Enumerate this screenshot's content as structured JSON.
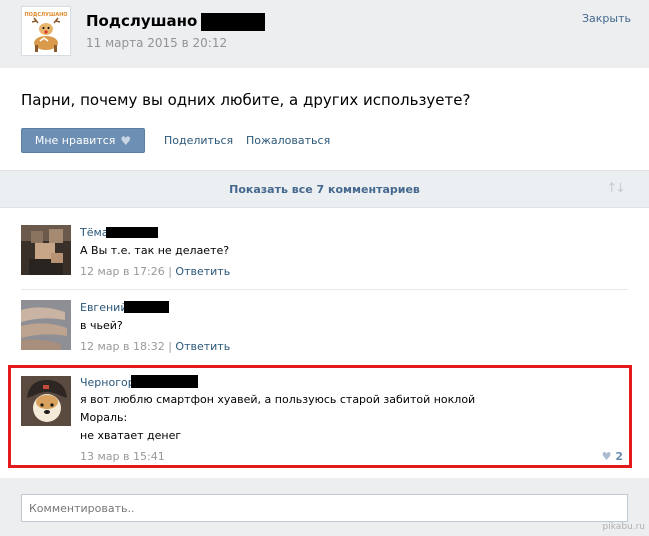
{
  "header": {
    "group_name": "Подслушано в",
    "logo_text": "ПОДСЛУШАНО",
    "post_date": "11 марта 2015 в 20:12",
    "close_label": "Закрыть"
  },
  "post": {
    "text": "Парни, почему вы одних любите, а других используете?",
    "like_label": "Мне нравится",
    "share_label": "Поделиться",
    "report_label": "Пожаловаться"
  },
  "comments_bar": {
    "show_all_label": "Показать все 7 комментариев"
  },
  "comments": [
    {
      "author": "Тёма",
      "text": "А Вы т.е. так не делаете?",
      "time": "12 мар в 17:26",
      "separator": "|",
      "reply": "Ответить"
    },
    {
      "author": "Евгений",
      "text": "в чьей?",
      "time": "12 мар в 18:32",
      "separator": "|",
      "reply": "Ответить"
    },
    {
      "author": "Черногор",
      "lines": [
        "я вот люблю смартфон хуавей, а пользуюсь старой забитой ноклой",
        "Мораль:",
        "не хватает денег"
      ],
      "time": "13 мар в 15:41",
      "likes": "2"
    }
  ],
  "footer": {
    "input_placeholder": "Комментировать..",
    "watermark": "pikabu.ru"
  },
  "colors": {
    "link": "#2b587a",
    "button": "#6d8fb3",
    "highlight": "#e21a1a"
  }
}
